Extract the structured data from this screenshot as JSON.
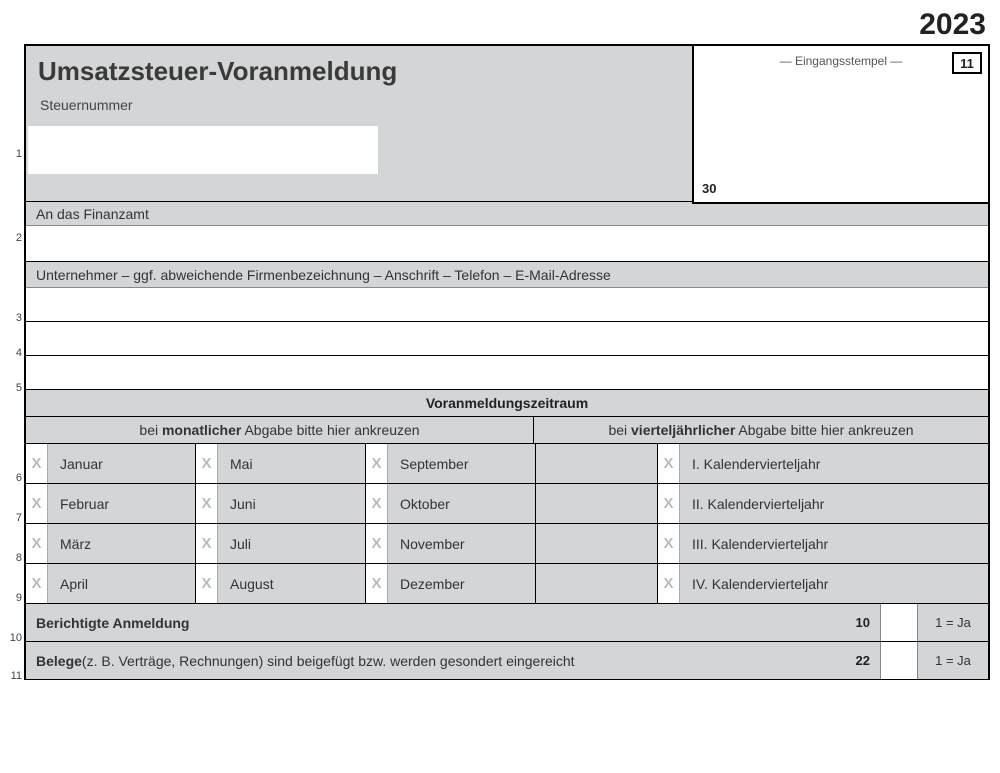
{
  "year": "2023",
  "title": "Umsatzsteuer-Voranmeldung",
  "steuernummer_label": "Steuernummer",
  "stamp": {
    "label": "— Eingangsstempel —",
    "corner": "11",
    "code30": "30"
  },
  "finanzamt_label": "An das Finanzamt",
  "unternehmer_label": "Unternehmer – ggf. abweichende Firmenbezeichnung – Anschrift – Telefon – E-Mail-Adresse",
  "section_period": "Voranmeldungszeitraum",
  "period_left_pre": "bei ",
  "period_left_bold": "monatlicher",
  "period_left_post": " Abgabe bitte hier ankreuzen",
  "period_right_pre": "bei ",
  "period_right_bold": "vierteljährlicher",
  "period_right_post": " Abgabe bitte hier ankreuzen",
  "x": "X",
  "months": {
    "r1": [
      "Januar",
      "Mai",
      "September"
    ],
    "r2": [
      "Februar",
      "Juni",
      "Oktober"
    ],
    "r3": [
      "März",
      "Juli",
      "November"
    ],
    "r4": [
      "April",
      "August",
      "Dezember"
    ]
  },
  "quarters": [
    "I. Kalendervierteljahr",
    "II. Kalendervierteljahr",
    "III. Kalendervierteljahr",
    "IV. Kalendervierteljahr"
  ],
  "row10": {
    "label": "Berichtigte Anmeldung",
    "code": "10",
    "yes": "1 = Ja"
  },
  "row11": {
    "label_bold": "Belege",
    "label_rest": " (z. B. Verträge, Rechnungen) sind beigefügt bzw. werden gesondert eingereicht",
    "code": "22",
    "yes": "1 = Ja"
  },
  "line_numbers": [
    "1",
    "2",
    "3",
    "4",
    "5",
    "6",
    "7",
    "8",
    "9",
    "10",
    "11"
  ]
}
